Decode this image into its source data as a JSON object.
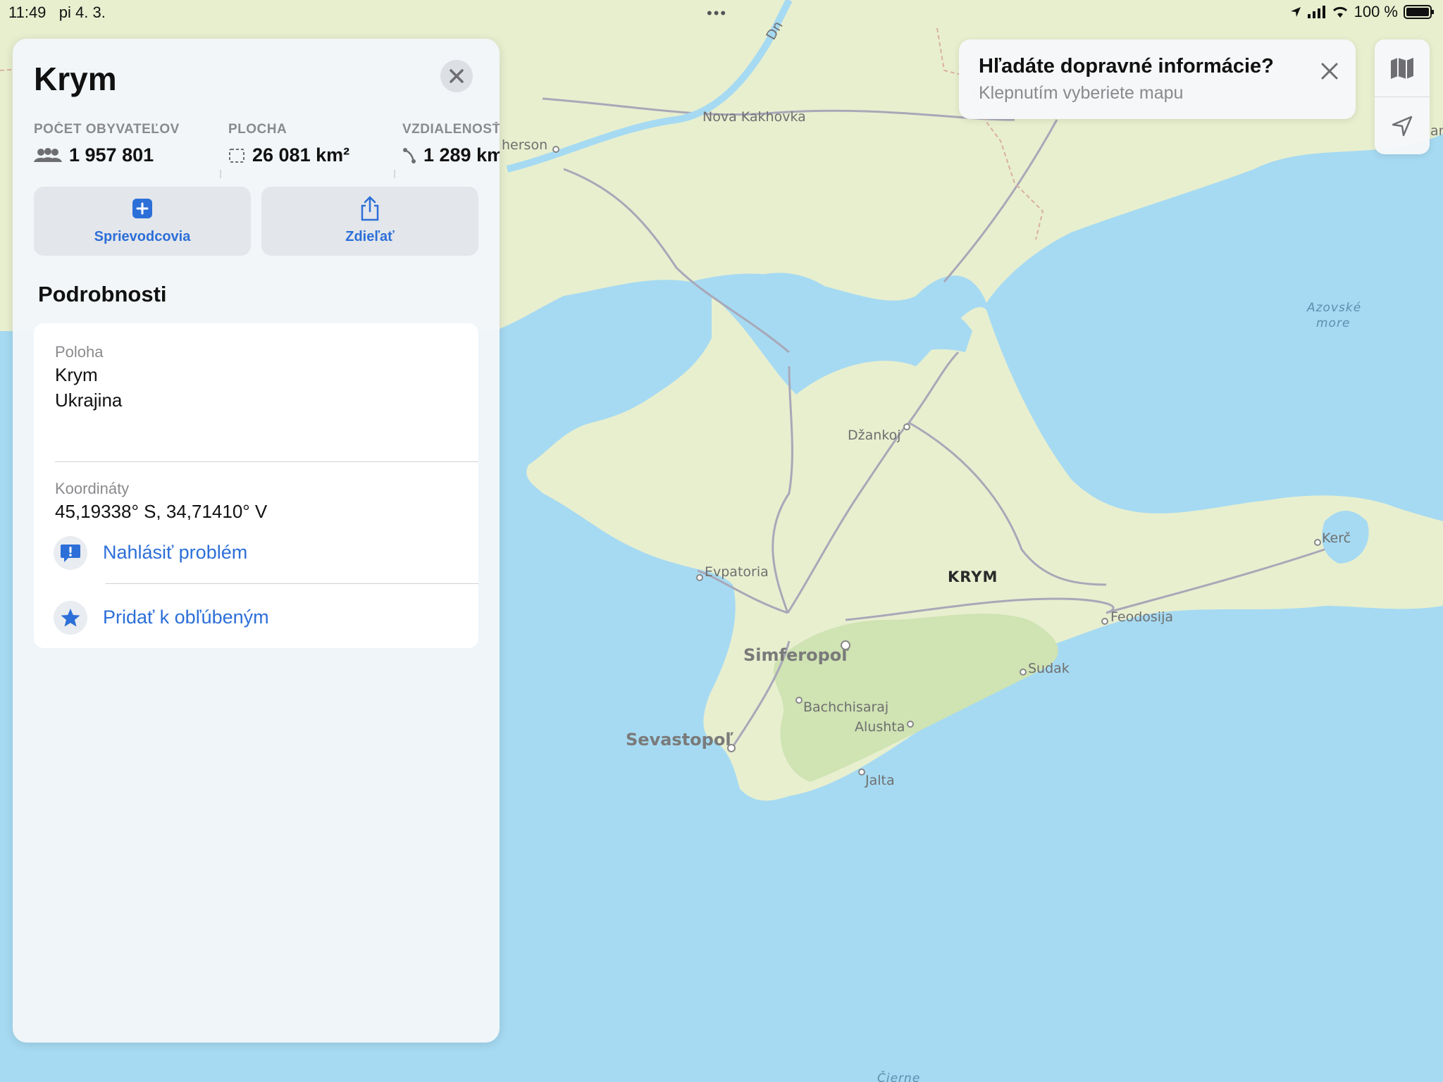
{
  "status_bar": {
    "time": "11:49",
    "date": "pi 4. 3.",
    "battery": "100 %"
  },
  "map": {
    "region_label": "KRYM",
    "sea_label_line1": "Azovské",
    "sea_label_line2": "more",
    "cities": {
      "nova_kakhovka": "Nova Kakhovka",
      "kherson": "herson",
      "dzankoj": "Džankoj",
      "evpatoria": "Evpatoria",
      "simferopol": "Simferopoľ",
      "sevastopol": "Sevastopoľ",
      "bachchisaraj": "Bachchisaraj",
      "alushta": "Alushta",
      "jalta": "Jalta",
      "sudak": "Sudak",
      "feodosija": "Feodosija",
      "kerc": "Kerč"
    },
    "river_label": "Dn",
    "bottom_label": "Čierne",
    "edge_label": "an"
  },
  "panel": {
    "title": "Krym",
    "stats": [
      {
        "label": "POČET OBYVATEĽOV",
        "value": "1 957 801",
        "icon": "people-icon"
      },
      {
        "label": "PLOCHA",
        "value": "26 081 km²",
        "icon": "area-icon"
      },
      {
        "label": "VZDIALENOSŤ",
        "value": "1 289 km",
        "icon": "distance-icon"
      }
    ],
    "actions": {
      "guides": "Sprievodcovia",
      "share": "Zdieľať"
    },
    "section_title": "Podrobnosti",
    "details": {
      "location_label": "Poloha",
      "location_line1": "Krym",
      "location_line2": "Ukrajina",
      "coords_label": "Koordináty",
      "coords_value": "45,19338° S, 34,71410° V"
    },
    "links": {
      "report": "Nahlásiť problém",
      "favorite": "Pridať k obľúbeným"
    }
  },
  "banner": {
    "title": "Hľadáte dopravné informácie?",
    "subtitle": "Klepnutím vyberiete mapu"
  },
  "colors": {
    "accent": "#2c6fd8",
    "water": "#a6daf2",
    "land": "#e8efcf",
    "forest": "#cfe3b3"
  }
}
